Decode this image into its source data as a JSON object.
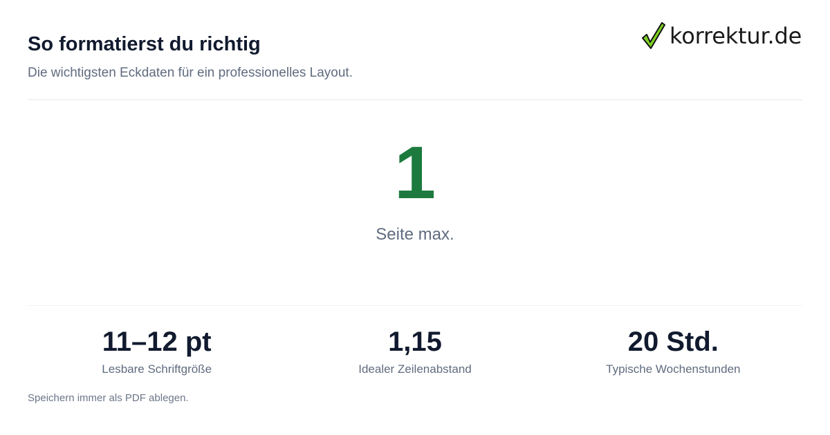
{
  "header": {
    "title": "So formatierst du richtig",
    "subtitle": "Die wichtigsten Eckdaten für ein professionelles Layout."
  },
  "logo": {
    "text": "korrektur.de",
    "icon": "checkmark-icon",
    "accent_color": "#7ed321"
  },
  "hero": {
    "value": "1",
    "label": "Seite max.",
    "color": "#1c7a3e"
  },
  "stats": [
    {
      "value": "11–12 pt",
      "label": "Lesbare Schriftgröße"
    },
    {
      "value": "1,15",
      "label": "Idealer Zeilenabstand"
    },
    {
      "value": "20 Std.",
      "label": "Typische Wochenstunden"
    }
  ],
  "footnote": "Speichern immer als PDF ablegen."
}
